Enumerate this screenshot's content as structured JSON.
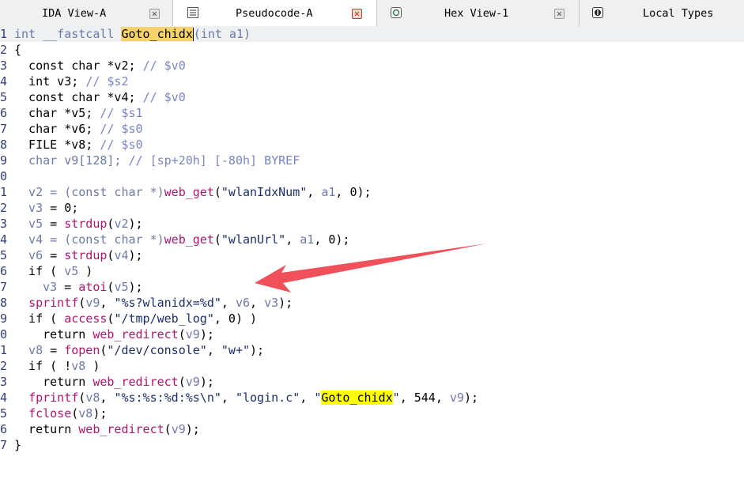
{
  "tabs": [
    {
      "label": "IDA View-A",
      "icon": "none",
      "active": false,
      "close_color": "gray"
    },
    {
      "label": "Pseudocode-A",
      "icon": "pseudocode-icon",
      "active": true,
      "close_color": "red"
    },
    {
      "label": "Hex View-1",
      "icon": "hex-view-icon",
      "active": false,
      "close_color": "gray"
    },
    {
      "label": "Local Types",
      "icon": "local-types-icon",
      "active": false,
      "close_color": "none"
    }
  ],
  "code": {
    "lines": [
      {
        "n": "1",
        "t": [
          [
            "int __fastcall ",
            "id"
          ],
          [
            "Goto_chidx",
            "hl2"
          ],
          [
            "",
            "cursor"
          ],
          [
            "(int a1)",
            "id"
          ]
        ]
      },
      {
        "n": "2",
        "t": [
          [
            "{",
            "kw"
          ]
        ]
      },
      {
        "n": "3",
        "t": [
          [
            "  const char *v2; ",
            "kw"
          ],
          [
            "// $v0",
            "cmt"
          ]
        ]
      },
      {
        "n": "4",
        "t": [
          [
            "  int v3; ",
            "kw"
          ],
          [
            "// $s2",
            "cmt"
          ]
        ]
      },
      {
        "n": "5",
        "t": [
          [
            "  const char *v4; ",
            "kw"
          ],
          [
            "// $v0",
            "cmt"
          ]
        ]
      },
      {
        "n": "6",
        "t": [
          [
            "  char *v5; ",
            "kw"
          ],
          [
            "// $s1",
            "cmt"
          ]
        ]
      },
      {
        "n": "7",
        "t": [
          [
            "  char *v6; ",
            "kw"
          ],
          [
            "// $s0",
            "cmt"
          ]
        ]
      },
      {
        "n": "8",
        "t": [
          [
            "  FILE *v8; ",
            "kw"
          ],
          [
            "// $s0",
            "cmt"
          ]
        ]
      },
      {
        "n": "9",
        "t": [
          [
            "  char v9[128]; ",
            "id"
          ],
          [
            "// [sp+20h] [-80h] BYREF",
            "cmt"
          ]
        ]
      },
      {
        "n": "0",
        "t": [
          [
            "",
            "kw"
          ]
        ]
      },
      {
        "n": "1",
        "t": [
          [
            "  v2 = ",
            "id"
          ],
          [
            "(const char *)",
            "id"
          ],
          [
            "web_get",
            "fn"
          ],
          [
            "(",
            "kw"
          ],
          [
            "\"wlanIdxNum\"",
            "str"
          ],
          [
            ", ",
            "kw"
          ],
          [
            "a1",
            "id"
          ],
          [
            ", 0);",
            "kw"
          ]
        ]
      },
      {
        "n": "2",
        "t": [
          [
            "  v3",
            "id"
          ],
          [
            " = 0;",
            "kw"
          ]
        ]
      },
      {
        "n": "3",
        "t": [
          [
            "  v5",
            "id"
          ],
          [
            " = ",
            "kw"
          ],
          [
            "strdup",
            "fn"
          ],
          [
            "(",
            "kw"
          ],
          [
            "v2",
            "id"
          ],
          [
            ");",
            "kw"
          ]
        ]
      },
      {
        "n": "4",
        "t": [
          [
            "  v4 = ",
            "id"
          ],
          [
            "(const char *)",
            "id"
          ],
          [
            "web_get",
            "fn"
          ],
          [
            "(",
            "kw"
          ],
          [
            "\"wlanUrl\"",
            "str"
          ],
          [
            ", ",
            "kw"
          ],
          [
            "a1",
            "id"
          ],
          [
            ", 0);",
            "kw"
          ]
        ]
      },
      {
        "n": "5",
        "t": [
          [
            "  v6",
            "id"
          ],
          [
            " = ",
            "kw"
          ],
          [
            "strdup",
            "fn"
          ],
          [
            "(",
            "kw"
          ],
          [
            "v4",
            "id"
          ],
          [
            ");",
            "kw"
          ]
        ]
      },
      {
        "n": "6",
        "t": [
          [
            "  if ( ",
            "kw"
          ],
          [
            "v5",
            "id"
          ],
          [
            " )",
            "kw"
          ]
        ]
      },
      {
        "n": "7",
        "t": [
          [
            "    v3",
            "id"
          ],
          [
            " = ",
            "kw"
          ],
          [
            "atoi",
            "fn"
          ],
          [
            "(",
            "kw"
          ],
          [
            "v5",
            "id"
          ],
          [
            ");",
            "kw"
          ]
        ]
      },
      {
        "n": "8",
        "t": [
          [
            "  ",
            "kw"
          ],
          [
            "sprintf",
            "fn"
          ],
          [
            "(",
            "kw"
          ],
          [
            "v9",
            "id"
          ],
          [
            ", ",
            "kw"
          ],
          [
            "\"%s?wlanidx=%d\"",
            "str"
          ],
          [
            ", ",
            "kw"
          ],
          [
            "v6",
            "id"
          ],
          [
            ", ",
            "kw"
          ],
          [
            "v3",
            "id"
          ],
          [
            ");",
            "kw"
          ]
        ]
      },
      {
        "n": "9",
        "t": [
          [
            "  if ( ",
            "kw"
          ],
          [
            "access",
            "fn"
          ],
          [
            "(",
            "kw"
          ],
          [
            "\"/tmp/web_log\"",
            "str"
          ],
          [
            ", 0) )",
            "kw"
          ]
        ]
      },
      {
        "n": "0",
        "t": [
          [
            "    return ",
            "kw"
          ],
          [
            "web_redirect",
            "fn"
          ],
          [
            "(",
            "kw"
          ],
          [
            "v9",
            "id"
          ],
          [
            ");",
            "kw"
          ]
        ]
      },
      {
        "n": "1",
        "t": [
          [
            "  v8",
            "id"
          ],
          [
            " = ",
            "kw"
          ],
          [
            "fopen",
            "fn"
          ],
          [
            "(",
            "kw"
          ],
          [
            "\"/dev/console\"",
            "str"
          ],
          [
            ", ",
            "kw"
          ],
          [
            "\"w+\"",
            "str"
          ],
          [
            ");",
            "kw"
          ]
        ]
      },
      {
        "n": "2",
        "t": [
          [
            "  if ( !",
            "kw"
          ],
          [
            "v8",
            "id"
          ],
          [
            " )",
            "kw"
          ]
        ]
      },
      {
        "n": "3",
        "t": [
          [
            "    return ",
            "kw"
          ],
          [
            "web_redirect",
            "fn"
          ],
          [
            "(",
            "kw"
          ],
          [
            "v9",
            "id"
          ],
          [
            ");",
            "kw"
          ]
        ]
      },
      {
        "n": "4",
        "t": [
          [
            "  ",
            "kw"
          ],
          [
            "fprintf",
            "fn"
          ],
          [
            "(",
            "kw"
          ],
          [
            "v8",
            "id"
          ],
          [
            ", ",
            "kw"
          ],
          [
            "\"%s:%s:%d:%s\\n\"",
            "str"
          ],
          [
            ", ",
            "kw"
          ],
          [
            "\"login.c\"",
            "str"
          ],
          [
            ", ",
            "kw"
          ],
          [
            "\"",
            "str"
          ],
          [
            "Goto_chidx",
            "hl"
          ],
          [
            "\"",
            "str"
          ],
          [
            ", 544, ",
            "kw"
          ],
          [
            "v9",
            "id"
          ],
          [
            ");",
            "kw"
          ]
        ]
      },
      {
        "n": "5",
        "t": [
          [
            "  ",
            "kw"
          ],
          [
            "fclose",
            "fn"
          ],
          [
            "(",
            "kw"
          ],
          [
            "v8",
            "id"
          ],
          [
            ");",
            "kw"
          ]
        ]
      },
      {
        "n": "6",
        "t": [
          [
            "  return ",
            "kw"
          ],
          [
            "web_redirect",
            "fn"
          ],
          [
            "(",
            "kw"
          ],
          [
            "v9",
            "id"
          ],
          [
            ");",
            "kw"
          ]
        ]
      },
      {
        "n": "7",
        "t": [
          [
            "}",
            "kw"
          ]
        ]
      }
    ]
  },
  "annotation": {
    "arrow_color": "#f0505a",
    "points_to_line": "17"
  }
}
